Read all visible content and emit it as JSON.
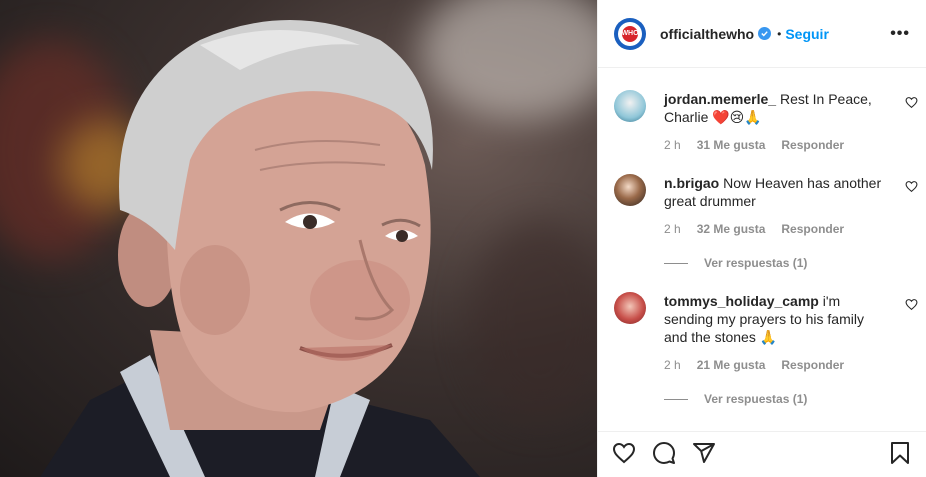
{
  "post": {
    "username": "officialthewho",
    "follow_label": "Seguir",
    "avatar_text": "WHO"
  },
  "comments": [
    {
      "username": "jordan.memerle_",
      "text": "Rest In Peace, Charlie ❤️😢🙏",
      "time": "2 h",
      "likes": "31 Me gusta",
      "reply_label": "Responder"
    },
    {
      "username": "n.brigao",
      "text": "Now Heaven has another great drummer",
      "time": "2 h",
      "likes": "32 Me gusta",
      "reply_label": "Responder",
      "view_replies": "Ver respuestas (1)"
    },
    {
      "username": "tommys_holiday_camp",
      "text": "i'm sending my prayers to his family and the stones 🙏",
      "time": "2 h",
      "likes": "21 Me gusta",
      "reply_label": "Responder",
      "view_replies": "Ver respuestas (1)"
    }
  ],
  "icons": {
    "like": "heart-icon",
    "comment": "comment-icon",
    "share": "send-icon",
    "save": "bookmark-icon",
    "verified": "verified-badge-icon",
    "more": "more-options-icon"
  },
  "colors": {
    "link": "#0095f6",
    "verified": "#3897f0",
    "muted": "#8e8e8e"
  }
}
